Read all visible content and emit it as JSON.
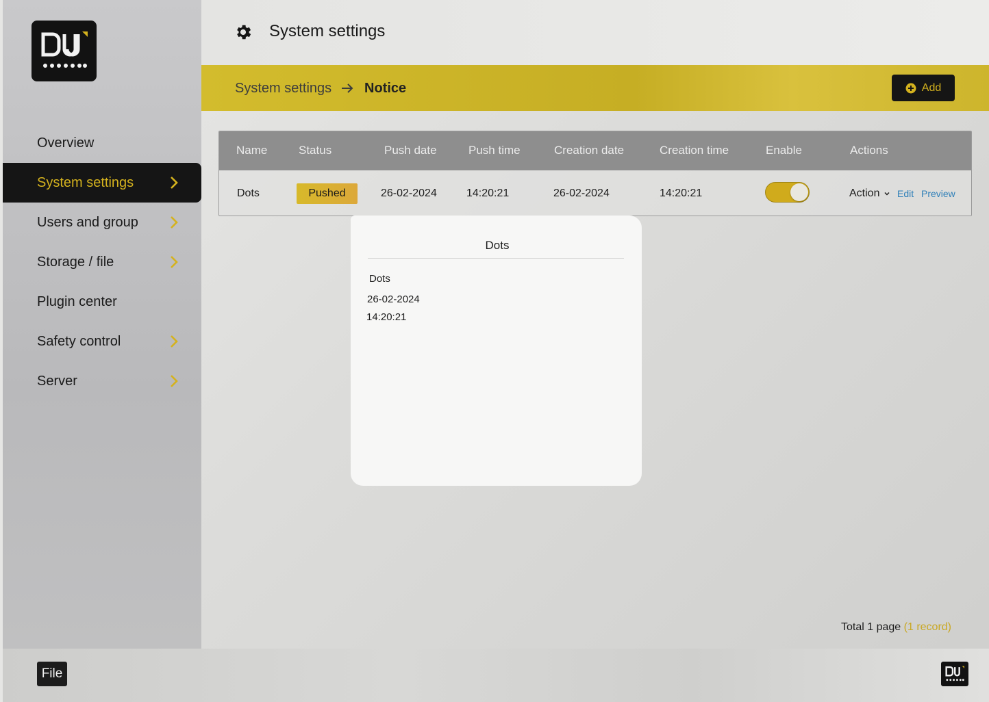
{
  "app": {
    "brand_color": "#d4b21e"
  },
  "header": {
    "title": "System settings"
  },
  "breadcrumb": {
    "parent": "System settings",
    "current": "Notice"
  },
  "toolbar": {
    "add_label": "Add"
  },
  "sidebar": {
    "items": [
      {
        "label": "Overview",
        "has_chevron": false
      },
      {
        "label": "System settings",
        "has_chevron": true,
        "active": true
      },
      {
        "label": "Users and group",
        "has_chevron": true
      },
      {
        "label": "Storage / file",
        "has_chevron": true
      },
      {
        "label": "Plugin center",
        "has_chevron": false
      },
      {
        "label": "Safety control",
        "has_chevron": true
      },
      {
        "label": "Server",
        "has_chevron": true
      }
    ]
  },
  "table": {
    "columns": [
      "Name",
      "Status",
      "Push date",
      "Push time",
      "Creation date",
      "Creation time",
      "Enable",
      "Actions"
    ],
    "rows": [
      {
        "name": "Dots",
        "status": "Pushed",
        "push_date": "26-02-2024",
        "push_time": "14:20:21",
        "creation_date": "26-02-2024",
        "creation_time": "14:20:21",
        "enabled": true,
        "action_label": "Action",
        "edit_label": "Edit",
        "preview_label": "Preview"
      }
    ]
  },
  "modal": {
    "title": "Dots",
    "name": "Dots",
    "date": "26-02-2024",
    "time": "14:20:21"
  },
  "pagination": {
    "total_label": "Total 1 page",
    "record_label": "(1 record)"
  },
  "footer": {
    "file_label": "File"
  }
}
